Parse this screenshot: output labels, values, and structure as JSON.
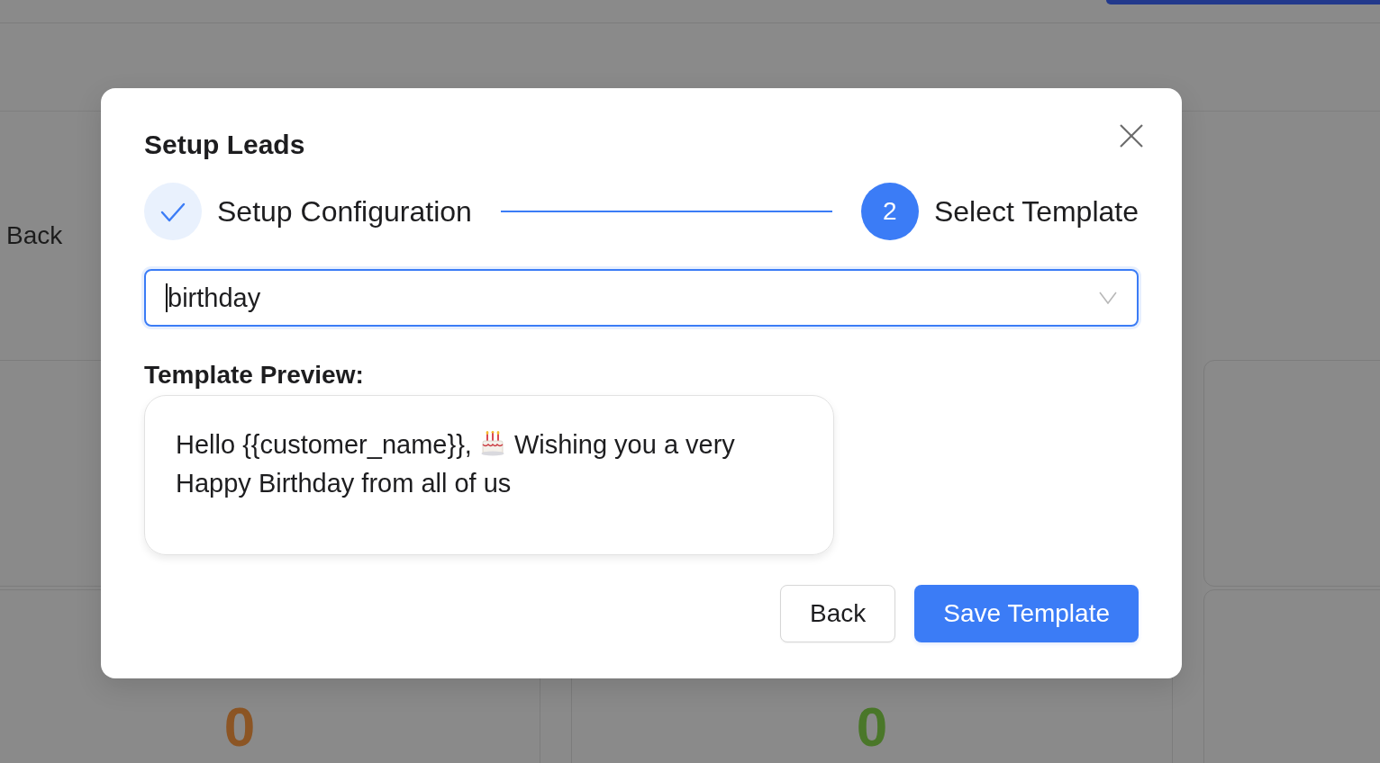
{
  "background_page": {
    "back_link": "Back",
    "stats": [
      {
        "value": "0",
        "color": "#8c5524"
      },
      {
        "value": "0",
        "color": "#4a7729"
      }
    ]
  },
  "dialog": {
    "title": "Setup Leads",
    "steps": [
      {
        "label": "Setup Configuration",
        "completed": true,
        "selected": false
      },
      {
        "label": "Select Template",
        "number": "2",
        "completed": false,
        "selected": true
      }
    ],
    "template_select": {
      "value": "birthday",
      "focused": true
    },
    "preview": {
      "label": "Template Preview:",
      "greeting": "Hello {{customer_name}},",
      "message": "Wishing you a very Happy Birthday from all of us"
    },
    "buttons": [
      {
        "label": "Back",
        "kind": "secondary"
      },
      {
        "label": "Save Template",
        "kind": "primary"
      }
    ]
  }
}
